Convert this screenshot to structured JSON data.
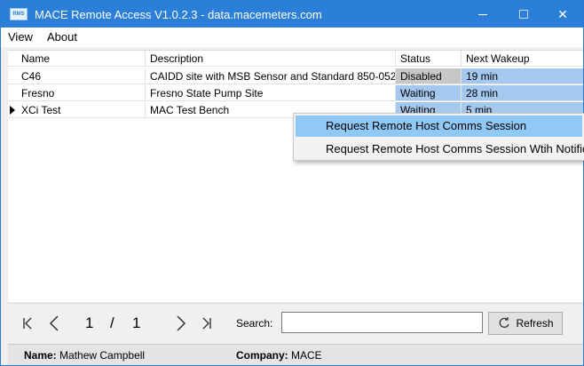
{
  "window": {
    "icon_text": "RMS",
    "title": "MACE Remote Access V1.0.2.3 - data.macemeters.com",
    "min_glyph": "—",
    "close_glyph": "✕"
  },
  "menu": [
    {
      "label": "View"
    },
    {
      "label": "About"
    }
  ],
  "grid": {
    "columns": [
      "Name",
      "Description",
      "Status",
      "Next Wakeup"
    ],
    "rows": [
      {
        "name": "C46",
        "description": "CAIDD site with MSB Sensor and Standard 850-052",
        "status": "Disabled",
        "next_wakeup": "19 min",
        "selected": false
      },
      {
        "name": "Fresno",
        "description": "Fresno State Pump Site",
        "status": "Waiting",
        "next_wakeup": "28 min",
        "selected": false
      },
      {
        "name": "XCi Test",
        "description": "MAC Test Bench",
        "status": "Waiting",
        "next_wakeup": "5 min",
        "selected": true
      }
    ]
  },
  "context_menu": {
    "items": [
      {
        "label": "Request Remote Host Comms Session",
        "highlighted": true
      },
      {
        "label": "Request Remote Host Comms Session Wtih Notification",
        "highlighted": false
      }
    ]
  },
  "pager": {
    "current_page": "1",
    "separator": "/",
    "total_pages": "1",
    "search_label": "Search:",
    "search_value": "",
    "refresh_label": "Refresh"
  },
  "status_bar": {
    "name_label": "Name:",
    "name_value": "Mathew Campbell",
    "company_label": "Company:",
    "company_value": "MACE"
  },
  "colors": {
    "titlebar": "#2b7fd8",
    "status_disabled": "#c7c7c7",
    "status_waiting": "#a4c8ee",
    "menu_highlight": "#90c8f6"
  }
}
